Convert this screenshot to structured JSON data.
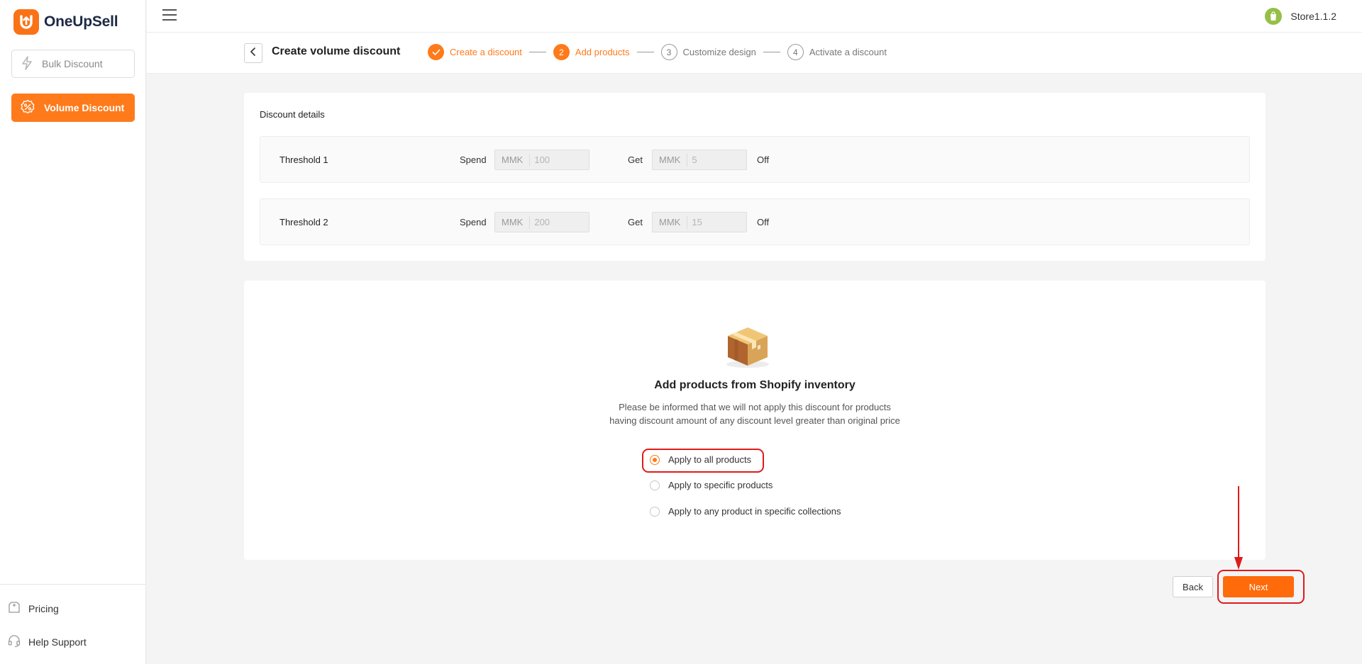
{
  "app": {
    "name": "OneUpSell"
  },
  "sidebar": {
    "items": [
      {
        "label": "Bulk Discount",
        "icon": "lightning-icon"
      },
      {
        "label": "Volume Discount",
        "icon": "percent-badge-icon",
        "active": true
      }
    ],
    "bottom": [
      {
        "label": "Pricing",
        "icon": "tag-icon"
      },
      {
        "label": "Help Support",
        "icon": "headset-icon"
      }
    ]
  },
  "topbar": {
    "store_name": "Store1.1.2"
  },
  "header": {
    "title": "Create volume discount",
    "steps": [
      {
        "number": "1",
        "label": "Create a discount",
        "state": "done"
      },
      {
        "number": "2",
        "label": "Add products",
        "state": "active"
      },
      {
        "number": "3",
        "label": "Customize design",
        "state": "todo"
      },
      {
        "number": "4",
        "label": "Activate a discount",
        "state": "todo"
      }
    ]
  },
  "discount_details": {
    "title": "Discount details",
    "thresholds": [
      {
        "name": "Threshold 1",
        "spend_label": "Spend",
        "spend_currency": "MMK",
        "spend_value": "100",
        "get_label": "Get",
        "get_currency": "MMK",
        "get_value": "5",
        "suffix": "Off"
      },
      {
        "name": "Threshold 2",
        "spend_label": "Spend",
        "spend_currency": "MMK",
        "spend_value": "200",
        "get_label": "Get",
        "get_currency": "MMK",
        "get_value": "15",
        "suffix": "Off"
      }
    ]
  },
  "products": {
    "title": "Add products from Shopify inventory",
    "description_line1": "Please be informed that we will not apply this discount for products",
    "description_line2": "having discount amount of any discount level greater than original price",
    "options": [
      {
        "label": "Apply to all products",
        "selected": true
      },
      {
        "label": "Apply to specific products",
        "selected": false
      },
      {
        "label": "Apply to any product in specific collections",
        "selected": false
      }
    ]
  },
  "actions": {
    "back_label": "Back",
    "next_label": "Next"
  },
  "colors": {
    "accent": "#ff7a1a",
    "highlight": "#e01a1a",
    "shopify": "#95bf47"
  }
}
